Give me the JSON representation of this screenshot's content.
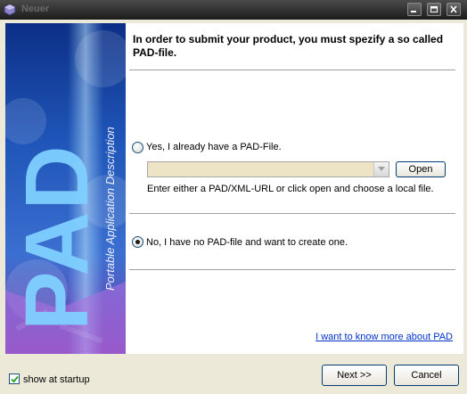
{
  "window": {
    "title": "Neuer"
  },
  "banner": {
    "big_text": "PAD",
    "sub_text": "Portable Application Description"
  },
  "content": {
    "heading": "In order to submit your product, you must spezify a so called PAD-file.",
    "option_yes_label": "Yes, I already have a PAD-File.",
    "option_yes_selected": false,
    "pad_url_value": "",
    "open_button_label": "Open",
    "hint_text": "Enter either a PAD/XML-URL or click open and choose a local file.",
    "option_no_label": "No, I have no PAD-file and want to create one.",
    "option_no_selected": true,
    "more_link_label": "I want to know more about PAD"
  },
  "footer": {
    "show_at_startup_label": "show at startup",
    "show_at_startup_checked": true,
    "next_button_label": "Next >>",
    "cancel_button_label": "Cancel"
  },
  "colors": {
    "banner_blue": "#3b6fd0",
    "banner_purple": "#7a3fb0",
    "link": "#0033cc"
  }
}
